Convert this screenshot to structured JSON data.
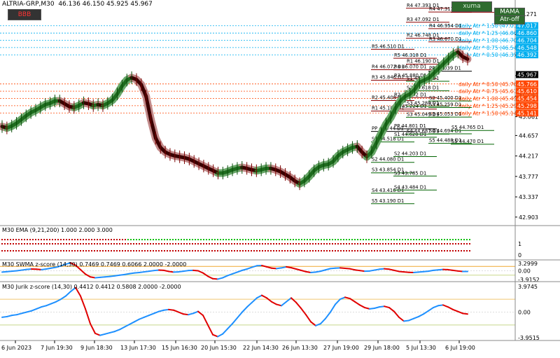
{
  "header": {
    "symbol_info": "ALTRIA-GRP,M30  46.136 46.150 45.925 45.967",
    "button_red": "BBB",
    "button_green": "xuma",
    "badge1": "MAMA",
    "badge2": "Atr-off"
  },
  "panels": {
    "ema_label": "M30 EMA (9,21,200) 1.000 2.000 3.000",
    "swma_label": "M30 SWMA z-score (14,30) 0.7469 0.7469 0.6066 2.0000 -2.0000",
    "jurik_label": "M30 Jurik z-score (14,30) 0.4412 0.4412 0.5808 2.0000 -2.0000"
  },
  "colors": {
    "up": "#1d6b1d",
    "band_up": "#6aa86a",
    "down": "#3a0000",
    "band_down": "#c28a8a",
    "pivot_resistance": "#8b0000",
    "pivot_support": "#006400",
    "atr_upper": "#00aeef",
    "atr_lower": "#ff4500",
    "price_label": "#000000",
    "blue_line": "#1e90ff",
    "red_line": "#e00000"
  },
  "chart_data": [
    {
      "type": "line",
      "title": "",
      "ylim": [
        42.75,
        47.45
      ],
      "y_ticks": [
        "47.271",
        "46.829",
        "46.387",
        "45.945",
        "45.503",
        "45.061",
        "44.657",
        "44.217",
        "43.777",
        "43.337",
        "42.903"
      ],
      "x_ticks": [
        "6 Jun 2023",
        "7 Jun 19:30",
        "9 Jun 18:30",
        "13 Jun 17:30",
        "15 Jun 16:30",
        "20 Jun 15:30",
        "22 Jun 14:30",
        "26 Jun 13:30",
        "27 Jun 19:00",
        "29 Jun 18:00",
        "5 Jul 13:30",
        "6 Jul 19:00"
      ],
      "series": [
        {
          "values": [
            44.85,
            44.82,
            44.86,
            44.92,
            45.0,
            45.08,
            45.15,
            45.2,
            45.26,
            45.32,
            45.35,
            45.4,
            45.4,
            45.34,
            45.28,
            45.26,
            45.3,
            45.36,
            45.34,
            45.3,
            45.32,
            45.3,
            45.35,
            45.42,
            45.55,
            45.72,
            45.85,
            45.9,
            45.86,
            45.75,
            45.5,
            45.0,
            44.6,
            44.4,
            44.3,
            44.25,
            44.22,
            44.2,
            44.18,
            44.15,
            44.1,
            44.05,
            44.0,
            43.95,
            43.9,
            43.85,
            43.85,
            43.88,
            43.92,
            43.95,
            43.97,
            43.95,
            43.92,
            43.9,
            43.92,
            43.95,
            43.95,
            43.92,
            43.88,
            43.82,
            43.76,
            43.68,
            43.62,
            43.68,
            43.78,
            43.9,
            43.98,
            44.02,
            44.04,
            44.1,
            44.22,
            44.3,
            44.35,
            44.4,
            44.42,
            44.3,
            44.2,
            44.3,
            44.5,
            44.7,
            44.9,
            45.05,
            45.25,
            45.4,
            45.5,
            45.55,
            45.65,
            45.8,
            45.85,
            45.9,
            46.0,
            46.1,
            46.2,
            46.3,
            46.4,
            46.45,
            46.35,
            46.3
          ]
        }
      ],
      "price_labels": [
        {
          "value": "47.271",
          "bg": "#ffffff",
          "fg": "#000000"
        },
        {
          "value": "47.017",
          "bg": "#00aeef",
          "fg": "#ffffff"
        },
        {
          "value": "46.860",
          "bg": "#00aeef",
          "fg": "#ffffff"
        },
        {
          "value": "46.704",
          "bg": "#00aeef",
          "fg": "#ffffff"
        },
        {
          "value": "46.548",
          "bg": "#00aeef",
          "fg": "#ffffff"
        },
        {
          "value": "46.392",
          "bg": "#00aeef",
          "fg": "#ffffff"
        },
        {
          "value": "45.967",
          "bg": "#000000",
          "fg": "#ffffff"
        },
        {
          "value": "45.766",
          "bg": "#ff4500",
          "fg": "#ffffff"
        },
        {
          "value": "45.610",
          "bg": "#ff4500",
          "fg": "#ffffff"
        },
        {
          "value": "45.454",
          "bg": "#ff4500",
          "fg": "#ffffff"
        },
        {
          "value": "45.298",
          "bg": "#ff4500",
          "fg": "#ffffff"
        },
        {
          "value": "45.141",
          "bg": "#ff4500",
          "fg": "#ffffff"
        }
      ],
      "atr_levels": [
        {
          "label": "daily Atr * 1.50 (47.017)",
          "value": 47.017,
          "kind": "upper"
        },
        {
          "label": "daily Atr * 1.25 (46.860)",
          "value": 46.86,
          "kind": "upper"
        },
        {
          "label": "daily Atr * 1.00 (46.704)",
          "value": 46.704,
          "kind": "upper"
        },
        {
          "label": "daily Atr * 0.75 (46.548)",
          "value": 46.548,
          "kind": "upper"
        },
        {
          "label": "daily Atr * 0.50 (46.392)",
          "value": 46.392,
          "kind": "upper"
        },
        {
          "label": "daily Atr * 0.50 (45.766)",
          "value": 45.766,
          "kind": "lower"
        },
        {
          "label": "daily Atr * 0.75 (45.610)",
          "value": 45.61,
          "kind": "lower"
        },
        {
          "label": "daily Atr * 1.00 (45.454)",
          "value": 45.454,
          "kind": "lower"
        },
        {
          "label": "daily Atr * 1.25 (45.298)",
          "value": 45.298,
          "kind": "lower"
        },
        {
          "label": "daily Atr * 1.50 (45.141)",
          "value": 45.141,
          "kind": "lower"
        }
      ],
      "pivots": [
        {
          "col": 0,
          "label": "R5 46.510 D1",
          "value": 46.51
        },
        {
          "col": 0,
          "label": "R4 46.072 D1",
          "value": 46.072
        },
        {
          "col": 0,
          "label": "R3 45.846 D1",
          "value": 45.846
        },
        {
          "col": 0,
          "label": "R2 45.408 D1",
          "value": 45.408
        },
        {
          "col": 0,
          "label": "R1 45.182 D1",
          "value": 45.182
        },
        {
          "col": 0,
          "label": "PP 44.744 D1",
          "value": 44.744
        },
        {
          "col": 0,
          "label": "S1 44.518 D1",
          "value": 44.518
        },
        {
          "col": 0,
          "label": "S2 44.080 D1",
          "value": 44.08
        },
        {
          "col": 0,
          "label": "S3 43.854 D1",
          "value": 43.854
        },
        {
          "col": 0,
          "label": "S4 43.416 D1",
          "value": 43.416
        },
        {
          "col": 0,
          "label": "S5 43.190 D1",
          "value": 43.19
        },
        {
          "col": 1,
          "label": "R5 46.318 D1",
          "value": 46.318
        },
        {
          "col": 1,
          "label": "R4 46.070 D1",
          "value": 46.07
        },
        {
          "col": 1,
          "label": "R3 45.880 D1",
          "value": 45.88
        },
        {
          "col": 1,
          "label": "R2 45.472 D1",
          "value": 45.472
        },
        {
          "col": 1,
          "label": "R1 45.224 D1",
          "value": 45.224
        },
        {
          "col": 1,
          "label": "PP 44.801 D1",
          "value": 44.801
        },
        {
          "col": 1,
          "label": "S1 44.620 D1",
          "value": 44.62
        },
        {
          "col": 1,
          "label": "S2 44.203 D1",
          "value": 44.203
        },
        {
          "col": 1,
          "label": "S3 43.785 D1",
          "value": 43.785
        },
        {
          "col": 1,
          "label": "S4 43.484 D1",
          "value": 43.484
        },
        {
          "col": 2,
          "label": "R4 47.393 D1",
          "value": 47.393
        },
        {
          "col": 2,
          "label": "R3 47.092 D1",
          "value": 47.092
        },
        {
          "col": 2,
          "label": "R2 46.748 D1",
          "value": 46.748
        },
        {
          "col": 2,
          "label": "R1 46.190 D1",
          "value": 46.19
        },
        {
          "col": 2,
          "label": "S1 45.824 D1",
          "value": 45.824
        },
        {
          "col": 2,
          "label": "S2 45.618 D1",
          "value": 45.618
        },
        {
          "col": 2,
          "label": "S3 45.288 D1",
          "value": 45.288
        },
        {
          "col": 2,
          "label": "S3 45.049 D1",
          "value": 45.049
        },
        {
          "col": 2,
          "label": "S4 44.687 D1",
          "value": 44.687
        },
        {
          "col": 3,
          "label": "R4 47.313 D1",
          "value": 47.313
        },
        {
          "col": 3,
          "label": "R4 46.954 D1",
          "value": 46.954
        },
        {
          "col": 3,
          "label": "R3 46.670 D1",
          "value": 46.67
        },
        {
          "col": 3,
          "label": "PP 46.039 D1",
          "value": 46.039
        },
        {
          "col": 3,
          "label": "S2 45.400 D1",
          "value": 45.4
        },
        {
          "col": 3,
          "label": "S3 45.259 D1",
          "value": 45.259
        },
        {
          "col": 3,
          "label": "S3 45.053 D1",
          "value": 45.053
        },
        {
          "col": 3,
          "label": "S4 44.694 D1",
          "value": 44.694
        },
        {
          "col": 3,
          "label": "S5 44.488 D1",
          "value": 44.488
        },
        {
          "col": 4,
          "label": "R4 47.305 D1",
          "value": 47.305
        },
        {
          "col": 4,
          "label": "S5 44.765 D1",
          "value": 44.765
        },
        {
          "col": 4,
          "label": "S5 44.470 D1",
          "value": 44.47
        }
      ]
    },
    {
      "type": "line",
      "title": "M30 SWMA z-score (14,30)",
      "ylim": [
        -4.3,
        4.3
      ],
      "y_ticks": [
        "3.2999",
        "0.00",
        "-3.9152"
      ],
      "series": [
        {
          "name": "z",
          "values": [
            -0.6,
            -0.4,
            -0.2,
            0.0,
            0.3,
            0.6,
            0.8,
            0.7,
            0.5,
            0.8,
            1.2,
            1.6,
            2.2,
            3.0,
            3.6,
            2.5,
            0.5,
            -1.5,
            -2.8,
            -3.2,
            -3.0,
            -2.8,
            -2.6,
            -2.3,
            -2.0,
            -1.7,
            -1.3,
            -1.0,
            -0.8,
            -0.5,
            -0.2,
            0.1,
            0.3,
            0.2,
            -0.3,
            -0.6,
            -0.5,
            -0.2,
            0.1,
            0.2,
            0.0,
            -1.0,
            -2.5,
            -3.6,
            -3.8,
            -3.2,
            -2.2,
            -1.4,
            -0.6,
            0.2,
            0.8,
            1.6,
            2.3,
            2.4,
            1.8,
            1.2,
            1.0,
            1.3,
            1.8,
            1.4,
            0.8,
            0.2,
            -0.4,
            -0.8,
            -0.6,
            -0.2,
            0.4,
            1.0,
            1.2,
            1.3,
            1.1,
            0.9,
            0.4,
            0.1,
            -0.2,
            -0.1,
            0.3,
            0.7,
            0.9,
            0.7,
            0.2,
            -0.3,
            -0.5,
            -0.7,
            -0.8,
            -0.6,
            -0.4,
            -0.2,
            0.2,
            0.4,
            0.6,
            0.5,
            0.2,
            -0.1,
            -0.3,
            -0.3
          ]
        }
      ]
    },
    {
      "type": "line",
      "title": "M30 Jurik z-score (14,30)",
      "ylim": [
        -4.4,
        4.4
      ],
      "y_ticks": [
        "3.9745",
        "0.00",
        "-3.9515"
      ],
      "series": [
        {
          "name": "z",
          "values": [
            -0.8,
            -0.7,
            -0.5,
            -0.4,
            -0.2,
            0.0,
            0.2,
            0.5,
            0.8,
            1.0,
            1.3,
            1.6,
            2.0,
            2.5,
            3.2,
            3.8,
            2.5,
            0.5,
            -1.8,
            -3.3,
            -3.6,
            -3.4,
            -3.2,
            -3.0,
            -2.7,
            -2.3,
            -1.9,
            -1.5,
            -1.1,
            -0.8,
            -0.5,
            -0.2,
            0.1,
            0.3,
            0.4,
            0.3,
            0.0,
            -0.3,
            -0.4,
            -0.2,
            0.1,
            -0.5,
            -2.0,
            -3.5,
            -3.8,
            -3.4,
            -2.6,
            -1.8,
            -0.9,
            0.0,
            0.8,
            1.5,
            2.2,
            2.6,
            2.2,
            1.6,
            1.2,
            1.0,
            1.6,
            2.2,
            1.5,
            0.6,
            -0.4,
            -1.5,
            -2.1,
            -1.8,
            -1.0,
            0.0,
            1.2,
            2.0,
            2.3,
            2.1,
            1.6,
            1.1,
            0.7,
            0.5,
            0.6,
            0.8,
            0.9,
            0.7,
            0.1,
            -0.8,
            -1.4,
            -1.3,
            -1.0,
            -0.7,
            -0.3,
            0.2,
            0.7,
            1.0,
            1.1,
            0.8,
            0.4,
            0.1,
            -0.2,
            -0.3
          ]
        }
      ]
    }
  ]
}
